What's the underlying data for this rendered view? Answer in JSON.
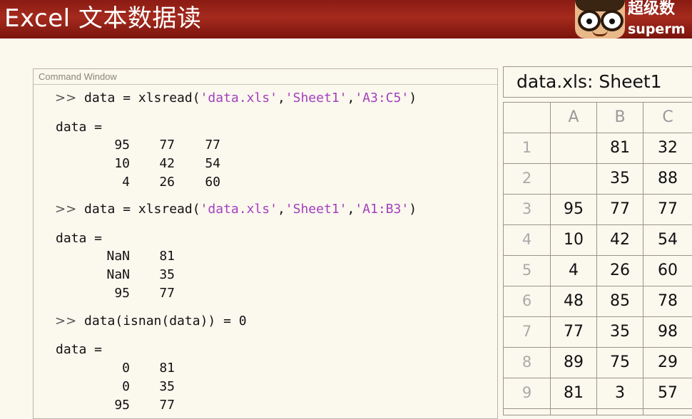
{
  "header": {
    "title": "Excel 文本数据读",
    "logo_cn": "超级数",
    "logo_en": "superm"
  },
  "command_window": {
    "caption": "Command Window",
    "prompt": ">>",
    "commands": [
      {
        "pre": " data = xlsread(",
        "args": [
          "'data.xls'",
          "'Sheet1'",
          "'A3:C5'"
        ],
        "post": ")"
      },
      {
        "pre": " data = xlsread(",
        "args": [
          "'data.xls'",
          "'Sheet1'",
          "'A1:B3'"
        ],
        "post": ")"
      },
      {
        "text": " data(isnan(data)) = 0"
      }
    ],
    "result_label": "data =",
    "results": [
      [
        [
          "95",
          "77",
          "77"
        ],
        [
          "10",
          "42",
          "54"
        ],
        [
          "4",
          "26",
          "60"
        ]
      ],
      [
        [
          "NaN",
          "81"
        ],
        [
          "NaN",
          "35"
        ],
        [
          "95",
          "77"
        ]
      ],
      [
        [
          "0",
          "81"
        ],
        [
          "0",
          "35"
        ],
        [
          "95",
          "77"
        ]
      ]
    ]
  },
  "spreadsheet": {
    "title": "data.xls:  Sheet1",
    "columns": [
      "A",
      "B",
      "C"
    ],
    "rows": [
      {
        "n": "1",
        "cells": [
          "",
          "81",
          "32"
        ]
      },
      {
        "n": "2",
        "cells": [
          "",
          "35",
          "88"
        ]
      },
      {
        "n": "3",
        "cells": [
          "95",
          "77",
          "77"
        ]
      },
      {
        "n": "4",
        "cells": [
          "10",
          "42",
          "54"
        ]
      },
      {
        "n": "5",
        "cells": [
          "4",
          "26",
          "60"
        ]
      },
      {
        "n": "6",
        "cells": [
          "48",
          "85",
          "78"
        ]
      },
      {
        "n": "7",
        "cells": [
          "77",
          "35",
          "98"
        ]
      },
      {
        "n": "8",
        "cells": [
          "89",
          "75",
          "29"
        ]
      },
      {
        "n": "9",
        "cells": [
          "81",
          "3",
          "57"
        ]
      }
    ]
  },
  "colors": {
    "header_bg": "#9a2216",
    "string_literal": "#a33fbe",
    "page_bg": "#fbf8ee"
  }
}
